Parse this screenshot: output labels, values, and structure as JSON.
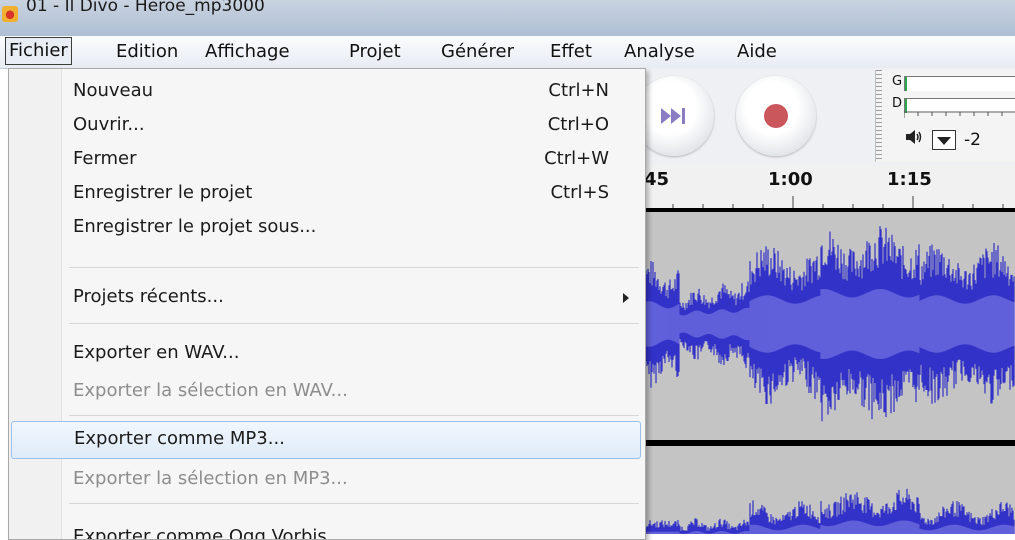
{
  "window": {
    "title": "01 - Il Divo - Heroe_mp3000"
  },
  "menubar": {
    "items": [
      "Fichier",
      "Edition",
      "Affichage",
      "Projet",
      "Générer",
      "Effet",
      "Analyse",
      "Aide"
    ]
  },
  "file_menu": {
    "nouveau": {
      "label": "Nouveau",
      "shortcut": "Ctrl+N"
    },
    "ouvrir": {
      "label": "Ouvrir...",
      "shortcut": "Ctrl+O"
    },
    "fermer": {
      "label": "Fermer",
      "shortcut": "Ctrl+W"
    },
    "enregistrer": {
      "label": "Enregistrer le projet",
      "shortcut": "Ctrl+S"
    },
    "enregistrer_sous": {
      "label": "Enregistrer le projet sous..."
    },
    "recents": {
      "label": "Projets récents..."
    },
    "export_wav": {
      "label": "Exporter en WAV..."
    },
    "export_sel_wav": {
      "label": "Exporter la sélection en WAV..."
    },
    "export_mp3": {
      "label": "Exporter comme MP3..."
    },
    "export_sel_mp3": {
      "label": "Exporter la sélection en MP3..."
    },
    "export_ogg": {
      "label": "Exporter comme Ogg Vorbis..."
    }
  },
  "meter": {
    "left_label": "G",
    "right_label": "D",
    "value_partial": "-2"
  },
  "ruler": {
    "labels": [
      "45",
      "1:00",
      "1:15"
    ]
  },
  "colors": {
    "waveform_outer": "#3232c8",
    "waveform_inner": "#6464dc",
    "track_bg": "#c4c4c4",
    "menu_highlight": "#deebf9"
  }
}
